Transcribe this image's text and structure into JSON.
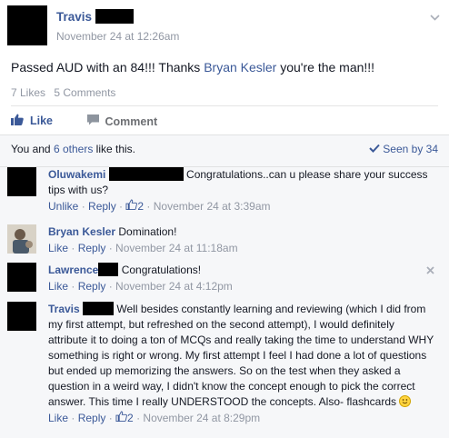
{
  "post": {
    "author": "Travis",
    "timestamp": "November 24 at 12:26am",
    "text_before": "Passed AUD with an 84!!! Thanks ",
    "mention": "Bryan Kesler",
    "text_after": " you're the man!!!",
    "likes_count": "7 Likes",
    "comments_count": "5 Comments",
    "actions": {
      "like": "Like",
      "comment": "Comment"
    }
  },
  "likes_bar": {
    "prefix": "You and ",
    "others": "6 others",
    "suffix": " like this.",
    "seen": "Seen by 34"
  },
  "comments": [
    {
      "name": "Oluwakemi",
      "text": "Congratulations..can u please share your success tips with us?",
      "meta_unlike": "Unlike",
      "meta_reply": "Reply",
      "like_count": "2",
      "time": "November 24 at 3:39am"
    },
    {
      "name": "Bryan Kesler",
      "text": "Domination!",
      "meta_like": "Like",
      "meta_reply": "Reply",
      "time": "November 24 at 11:18am"
    },
    {
      "name": "Lawrence",
      "text": "Congratulations!",
      "meta_like": "Like",
      "meta_reply": "Reply",
      "time": "November 24 at 4:12pm"
    },
    {
      "name": "Travis",
      "text": "Well besides constantly learning and reviewing (which I did from my first attempt, but refreshed on the second attempt), I would definitely attribute it to doing a ton of MCQs and really taking the time to understand WHY something is right or wrong. My first attempt I feel I had done a lot of questions but ended up memorizing the answers. So on the test when they asked a question in a weird way, I didn't know the concept enough to pick the correct answer. This time I really UNDERSTOOD the concepts. Also- flashcards",
      "meta_like": "Like",
      "meta_reply": "Reply",
      "like_count": "2",
      "time": "November 24 at 8:29pm"
    }
  ],
  "separator": " · ",
  "colors": {
    "link": "#3b5998",
    "muted": "#9197a3",
    "comment_bg": "#f6f7f9"
  },
  "icons": [
    "chevron-down-icon",
    "thumbs-up-icon",
    "comment-bubble-icon",
    "check-icon",
    "close-icon",
    "smiley-icon"
  ]
}
